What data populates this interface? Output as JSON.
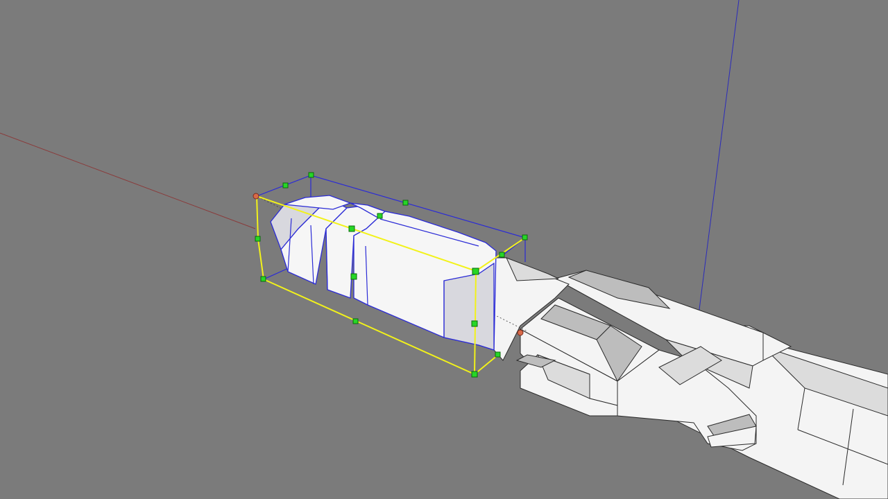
{
  "app": {
    "view": "3d-modeling-viewport",
    "background_color": "#7b7b7b"
  },
  "axes": {
    "red_axis_color": "#8a3a3a",
    "blue_axis_color": "#2b2bbb"
  },
  "selection": {
    "bounding_box_front_color": "#f2f21a",
    "bounding_box_back_color": "#2b2bd6",
    "grip_color": "#26d626",
    "grip_icon": "scale-grip-icon",
    "grip_count": 17
  },
  "model": {
    "selected_part": "nose-cone-component",
    "attached_part": "barrel-assembly-component"
  }
}
